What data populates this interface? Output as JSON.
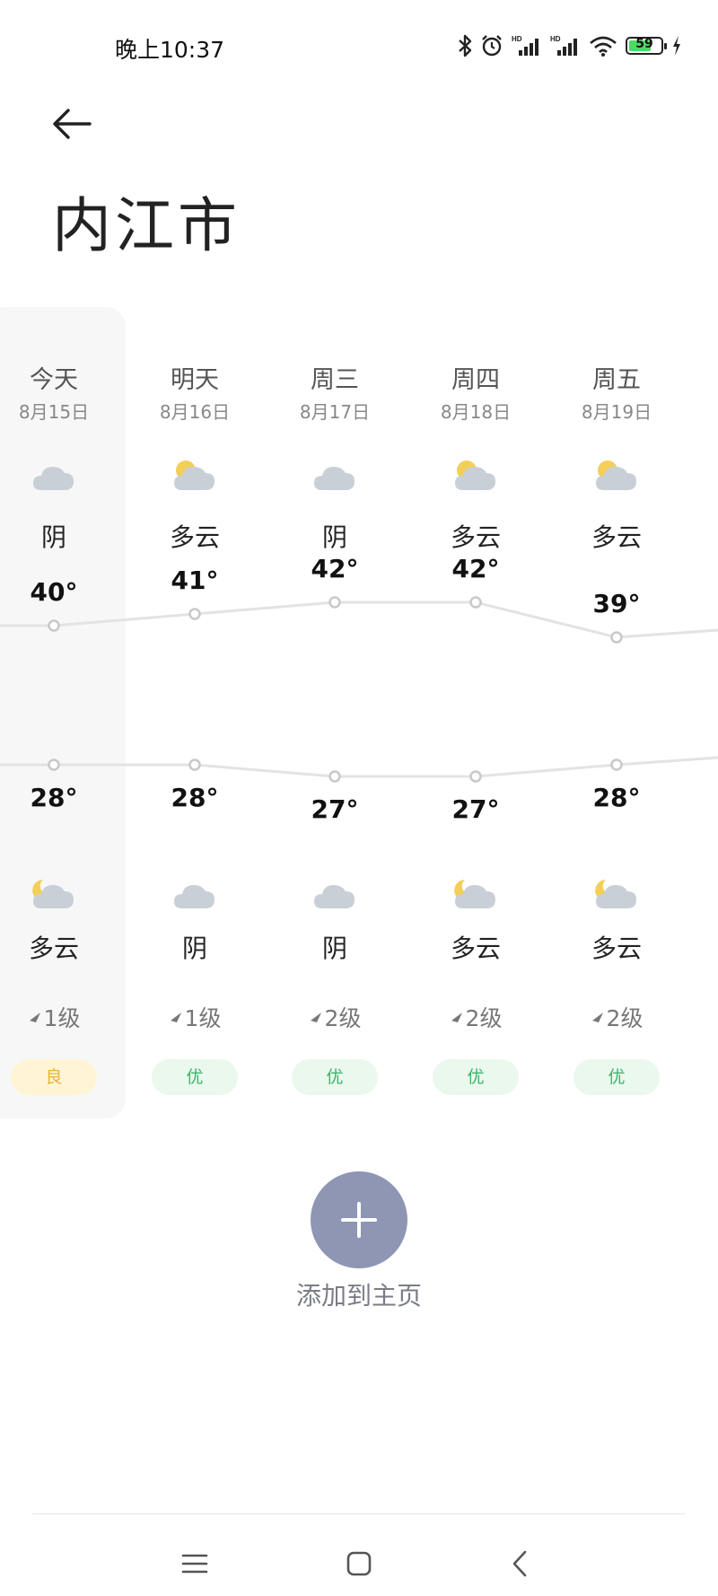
{
  "status_bar": {
    "time": "晚上10:37",
    "battery": "59",
    "icons": [
      "bluetooth-icon",
      "alarm-icon",
      "signal-hd-icon",
      "signal-hd-icon",
      "wifi-icon",
      "battery-icon",
      "charging-icon"
    ]
  },
  "header": {
    "back_icon": "arrow-left-icon",
    "city": "内江市"
  },
  "forecast": {
    "days": [
      {
        "name": "今天",
        "date": "8月15日",
        "day_cond": "阴",
        "day_icon": "overcast-icon",
        "high": "40°",
        "low": "28°",
        "night_cond": "多云",
        "night_icon": "partly-cloudy-night-icon",
        "wind": "1级",
        "aqi": "良",
        "aqi_level": "good"
      },
      {
        "name": "明天",
        "date": "8月16日",
        "day_cond": "多云",
        "day_icon": "partly-cloudy-day-icon",
        "high": "41°",
        "low": "28°",
        "night_cond": "阴",
        "night_icon": "overcast-icon",
        "wind": "1级",
        "aqi": "优",
        "aqi_level": "excellent"
      },
      {
        "name": "周三",
        "date": "8月17日",
        "day_cond": "阴",
        "day_icon": "overcast-icon",
        "high": "42°",
        "low": "27°",
        "night_cond": "阴",
        "night_icon": "overcast-icon",
        "wind": "2级",
        "aqi": "优",
        "aqi_level": "excellent"
      },
      {
        "name": "周四",
        "date": "8月18日",
        "day_cond": "多云",
        "day_icon": "partly-cloudy-day-icon",
        "high": "42°",
        "low": "27°",
        "night_cond": "多云",
        "night_icon": "partly-cloudy-night-icon",
        "wind": "2级",
        "aqi": "优",
        "aqi_level": "excellent"
      },
      {
        "name": "周五",
        "date": "8月19日",
        "day_cond": "多云",
        "day_icon": "partly-cloudy-day-icon",
        "high": "39°",
        "low": "28°",
        "night_cond": "多云",
        "night_icon": "partly-cloudy-night-icon",
        "wind": "2级",
        "aqi": "优",
        "aqi_level": "excellent"
      }
    ],
    "high_values": [
      40,
      41,
      42,
      42,
      39
    ],
    "low_values": [
      28,
      28,
      27,
      27,
      28
    ]
  },
  "add_to_home": {
    "icon": "plus-icon",
    "label": "添加到主页"
  },
  "nav_bar": {
    "icons": [
      "menu-icon",
      "home-icon",
      "back-icon"
    ]
  },
  "colors": {
    "accent_button": "#8f96b3",
    "aqi_good": "#e9b23a",
    "aqi_excellent": "#3bb56b",
    "line": "#e3e3e3"
  }
}
